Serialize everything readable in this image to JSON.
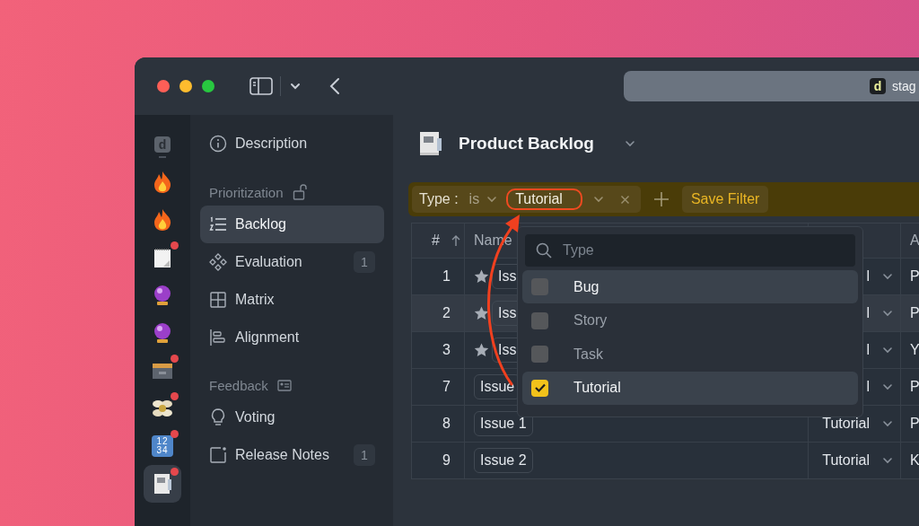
{
  "window": {
    "address_bar": {
      "logo": "d",
      "text": "stag"
    }
  },
  "rail": [
    {
      "label": "d",
      "selected": false,
      "unread": false
    },
    {
      "selected": false,
      "unread": false
    },
    {
      "selected": false,
      "unread": false
    },
    {
      "selected": false,
      "unread": true
    },
    {
      "selected": false,
      "unread": false
    },
    {
      "selected": false,
      "unread": false
    },
    {
      "selected": false,
      "unread": true
    },
    {
      "selected": false,
      "unread": true
    },
    {
      "digits": [
        "12",
        "34"
      ],
      "selected": false,
      "unread": true
    },
    {
      "selected": true,
      "unread": true
    }
  ],
  "sidebar": {
    "items": [
      {
        "kind": "link",
        "label": "Description",
        "selected": false
      },
      {
        "kind": "section",
        "label": "Prioritization"
      },
      {
        "kind": "link",
        "label": "Backlog",
        "selected": true
      },
      {
        "kind": "link",
        "label": "Evaluation",
        "count": "1",
        "selected": false
      },
      {
        "kind": "link",
        "label": "Matrix",
        "selected": false
      },
      {
        "kind": "link",
        "label": "Alignment",
        "selected": false
      },
      {
        "kind": "section",
        "label": "Feedback"
      },
      {
        "kind": "link",
        "label": "Voting",
        "selected": false
      },
      {
        "kind": "link",
        "label": "Release Notes",
        "count": "1",
        "selected": false
      }
    ]
  },
  "page": {
    "title": "Product Backlog"
  },
  "filter": {
    "field": "Type :",
    "operator": "is",
    "value": "Tutorial",
    "save_label": "Save Filter"
  },
  "table": {
    "columns": [
      {
        "label": "#",
        "sorted": true
      },
      {
        "label": "Name",
        "sorted": false
      },
      {},
      {
        "label": "A",
        "sorted": false
      }
    ],
    "rows": [
      {
        "number": "1",
        "starred": true,
        "name": "Iss",
        "type": "l",
        "column_4": "P",
        "selected": false
      },
      {
        "number": "2",
        "starred": true,
        "name": "Iss",
        "type": "l",
        "column_4": "P",
        "selected": true
      },
      {
        "number": "3",
        "starred": true,
        "name": "Iss",
        "type": "l",
        "column_4": "Y",
        "selected": false
      },
      {
        "number": "7",
        "starred": false,
        "name": "Issue",
        "type": "l",
        "column_4": "P",
        "selected": false
      },
      {
        "number": "8",
        "starred": false,
        "name": "Issue 1",
        "type": "Tutorial",
        "column_4": "P",
        "selected": false
      },
      {
        "number": "9",
        "starred": false,
        "name": "Issue 2",
        "type": "Tutorial",
        "column_4": "K",
        "selected": false
      }
    ]
  },
  "dropdown": {
    "placeholder": "Type",
    "options": [
      {
        "label": "Bug",
        "checked": false,
        "highlighted": true
      },
      {
        "label": "Story",
        "checked": false,
        "highlighted": false
      },
      {
        "label": "Task",
        "checked": false,
        "highlighted": false
      },
      {
        "label": "Tutorial",
        "checked": true,
        "highlighted": true
      }
    ]
  }
}
